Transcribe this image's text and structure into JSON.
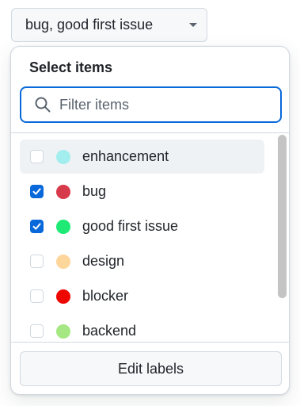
{
  "trigger": {
    "label": "bug, good first issue",
    "icon": "caret-down-icon"
  },
  "panel": {
    "title": "Select items",
    "filter": {
      "placeholder": "Filter items",
      "value": "",
      "icon": "search-icon"
    },
    "items": [
      {
        "label": "enhancement",
        "color": "#a2eeef",
        "checked": false,
        "hovered": true
      },
      {
        "label": "bug",
        "color": "#d73a4a",
        "checked": true,
        "hovered": false
      },
      {
        "label": "good first issue",
        "color": "#1ee975",
        "checked": true,
        "hovered": false
      },
      {
        "label": "design",
        "color": "#fdd69b",
        "checked": false,
        "hovered": false
      },
      {
        "label": "blocker",
        "color": "#ee0701",
        "checked": false,
        "hovered": false
      },
      {
        "label": "backend",
        "color": "#a5e883",
        "checked": false,
        "hovered": false
      }
    ],
    "footer_button": "Edit labels"
  },
  "colors": {
    "accent": "#0969da",
    "border": "#d1d9e0",
    "hover_bg": "#eff2f5",
    "button_bg": "#f6f8fa"
  }
}
